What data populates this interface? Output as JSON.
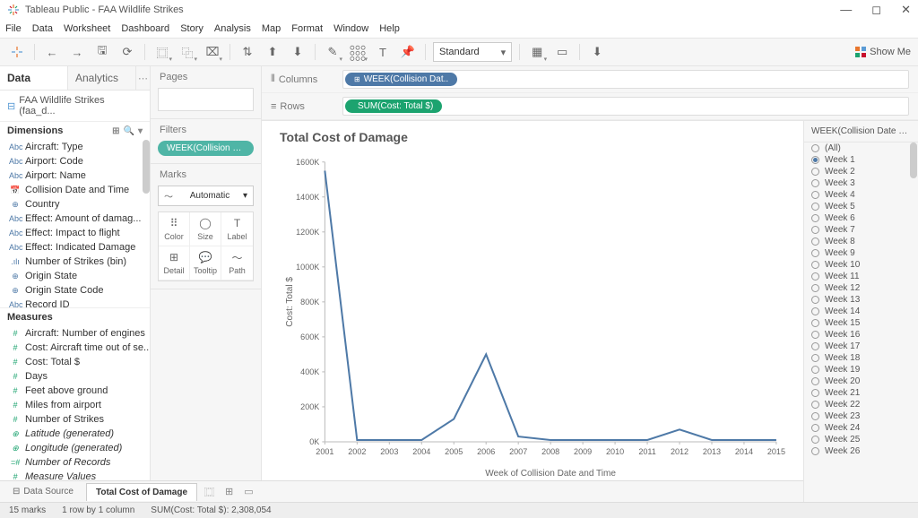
{
  "title": "Tableau Public - FAA Wildlife Strikes",
  "menu": [
    "File",
    "Data",
    "Worksheet",
    "Dashboard",
    "Story",
    "Analysis",
    "Map",
    "Format",
    "Window",
    "Help"
  ],
  "toolbar": {
    "fit": "Standard",
    "showme": "Show Me"
  },
  "datapane": {
    "tabs": {
      "data": "Data",
      "analytics": "Analytics"
    },
    "source": "FAA Wildlife Strikes (faa_d...",
    "dim_header": "Dimensions",
    "mea_header": "Measures",
    "dims": [
      {
        "icon": "Abc",
        "label": "Aircraft: Type"
      },
      {
        "icon": "Abc",
        "label": "Airport: Code"
      },
      {
        "icon": "Abc",
        "label": "Airport: Name"
      },
      {
        "icon": "📅",
        "label": "Collision Date and Time"
      },
      {
        "icon": "⊕",
        "label": "Country"
      },
      {
        "icon": "Abc",
        "label": "Effect: Amount of damag..."
      },
      {
        "icon": "Abc",
        "label": "Effect: Impact to flight"
      },
      {
        "icon": "Abc",
        "label": "Effect: Indicated Damage"
      },
      {
        "icon": ".ılı",
        "label": "Number of Strikes (bin)"
      },
      {
        "icon": "⊕",
        "label": "Origin State"
      },
      {
        "icon": "⊕",
        "label": "Origin State Code"
      },
      {
        "icon": "Abc",
        "label": "Record ID"
      }
    ],
    "meas": [
      {
        "icon": "#",
        "label": "Aircraft: Number of engines",
        "italic": false
      },
      {
        "icon": "#",
        "label": "Cost: Aircraft time out of se...",
        "italic": false
      },
      {
        "icon": "#",
        "label": "Cost: Total $",
        "italic": false
      },
      {
        "icon": "#",
        "label": "Days",
        "italic": false
      },
      {
        "icon": "#",
        "label": "Feet above ground",
        "italic": false
      },
      {
        "icon": "#",
        "label": "Miles from airport",
        "italic": false
      },
      {
        "icon": "#",
        "label": "Number of Strikes",
        "italic": false
      },
      {
        "icon": "⊕",
        "label": "Latitude (generated)",
        "italic": true
      },
      {
        "icon": "⊕",
        "label": "Longitude (generated)",
        "italic": true
      },
      {
        "icon": "=#",
        "label": "Number of Records",
        "italic": true
      },
      {
        "icon": "#",
        "label": "Measure Values",
        "italic": true
      }
    ]
  },
  "cards": {
    "pages": "Pages",
    "filters": "Filters",
    "filter_pill": "WEEK(Collision Date...",
    "marks": "Marks",
    "marks_type": "Automatic",
    "marks_cells": [
      {
        "icon": "⠿",
        "label": "Color"
      },
      {
        "icon": "◯",
        "label": "Size"
      },
      {
        "icon": "T",
        "label": "Label"
      },
      {
        "icon": "⊞",
        "label": "Detail"
      },
      {
        "icon": "💬",
        "label": "Tooltip"
      },
      {
        "icon": "〜",
        "label": "Path"
      }
    ]
  },
  "shelves": {
    "columns": "Columns",
    "rows": "Rows",
    "col_pill": "WEEK(Collision Dat..",
    "row_pill": "SUM(Cost: Total $)"
  },
  "chart": {
    "title": "Total Cost of Damage",
    "ylabel": "Cost: Total $",
    "xlabel": "Week of Collision Date and Time"
  },
  "chart_data": {
    "type": "line",
    "title": "Total Cost of Damage",
    "xlabel": "Week of Collision Date and Time",
    "ylabel": "Cost: Total $",
    "ylim": [
      0,
      1600000
    ],
    "x": [
      2001,
      2002,
      2003,
      2004,
      2005,
      2006,
      2007,
      2008,
      2009,
      2010,
      2011,
      2012,
      2013,
      2014,
      2015
    ],
    "values": [
      1550000,
      10000,
      10000,
      10000,
      130000,
      500000,
      30000,
      10000,
      10000,
      10000,
      10000,
      70000,
      10000,
      10000,
      10000
    ],
    "yticks": [
      "0K",
      "200K",
      "400K",
      "600K",
      "800K",
      "1000K",
      "1200K",
      "1400K",
      "1600K"
    ]
  },
  "filter_card": {
    "title": "WEEK(Collision Date an...",
    "all": "(All)",
    "selected": "Week 1",
    "items": [
      "Week 1",
      "Week 2",
      "Week 3",
      "Week 4",
      "Week 5",
      "Week 6",
      "Week 7",
      "Week 8",
      "Week 9",
      "Week 10",
      "Week 11",
      "Week 12",
      "Week 13",
      "Week 14",
      "Week 15",
      "Week 16",
      "Week 17",
      "Week 18",
      "Week 19",
      "Week 20",
      "Week 21",
      "Week 22",
      "Week 23",
      "Week 24",
      "Week 25",
      "Week 26"
    ]
  },
  "sheetbar": {
    "datasource": "Data Source",
    "active": "Total Cost of Damage"
  },
  "status": {
    "marks": "15 marks",
    "dims": "1 row by 1 column",
    "sum": "SUM(Cost: Total $): 2,308,054"
  }
}
